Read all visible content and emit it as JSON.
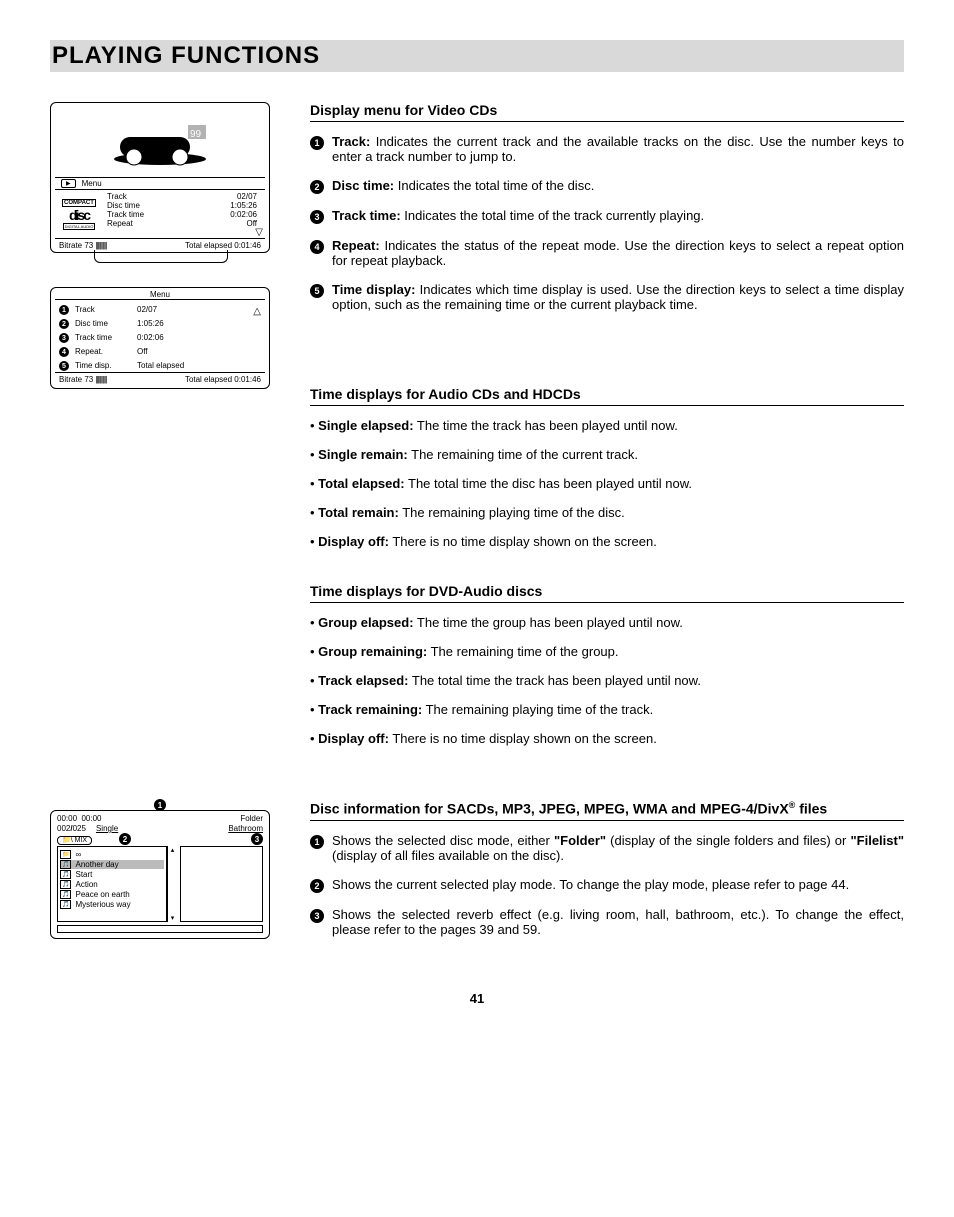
{
  "page_title": "PLAYING FUNCTIONS",
  "page_number": "41",
  "fig1": {
    "menu_label": "Menu",
    "rows": [
      {
        "label": "Track",
        "value": "02/07"
      },
      {
        "label": "Disc time",
        "value": "1:05:26"
      },
      {
        "label": "Track time",
        "value": "0:02:06"
      },
      {
        "label": "Repeat",
        "value": "Off"
      }
    ],
    "footer_left": "Bitrate 73",
    "footer_right": "Total elapsed 0:01:46",
    "compact_top": "COMPACT",
    "compact_bottom": "DIGITAL AUDIO"
  },
  "fig2": {
    "menu_label": "Menu",
    "rows": [
      {
        "num": "1",
        "label": "Track",
        "value": "02/07"
      },
      {
        "num": "2",
        "label": "Disc time",
        "value": "1:05:26"
      },
      {
        "num": "3",
        "label": "Track time",
        "value": "0:02:06"
      },
      {
        "num": "4",
        "label": "Repeat.",
        "value": "Off"
      },
      {
        "num": "5",
        "label": "Time disp.",
        "value": "Total elapsed"
      }
    ],
    "footer_left": "Bitrate 73",
    "footer_right": "Total elapsed 0:01:46"
  },
  "fig3": {
    "top_left_a": "00:00",
    "top_left_b": "00:00",
    "top_right": "Folder",
    "sec_left_a": "002",
    "sec_left_b": "025",
    "sec_mid": "Single",
    "sec_reverb": "Bathroom",
    "mix_label": "MIX",
    "items": [
      {
        "icon": "📁",
        "label": "∞"
      },
      {
        "icon": "🎵",
        "label": "Another day",
        "sel": true
      },
      {
        "icon": "🎵",
        "label": "Start"
      },
      {
        "icon": "🎵",
        "label": "Action"
      },
      {
        "icon": "🎵",
        "label": "Peace on earth"
      },
      {
        "icon": "🎵",
        "label": "Mysterious way"
      }
    ],
    "scroll_up": "▴",
    "scroll_dn": "▾"
  },
  "sec1": {
    "heading": "Display menu for Video CDs",
    "items": [
      {
        "num": "1",
        "label": "Track:",
        "text": "Indicates the current track and the available tracks on the disc. Use the number keys to enter a track number to jump to."
      },
      {
        "num": "2",
        "label": "Disc time:",
        "text": "Indicates the total time of the disc."
      },
      {
        "num": "3",
        "label": "Track time:",
        "text": "Indicates the total time of the track currently playing."
      },
      {
        "num": "4",
        "label": "Repeat:",
        "text": "Indicates the status of the repeat mode. Use the direction keys to select a repeat option for repeat playback."
      },
      {
        "num": "5",
        "label": "Time display:",
        "text": "Indicates which time display is used. Use the direction keys to select a time display option, such as  the remaining time or the current playback time."
      }
    ]
  },
  "sec2": {
    "heading": "Time displays for Audio CDs and HDCDs",
    "items": [
      {
        "label": "Single elapsed:",
        "text": "The time the track has been played until now."
      },
      {
        "label": "Single remain:",
        "text": "The remaining time of the current track."
      },
      {
        "label": "Total elapsed:",
        "text": "The total time the disc has been played until now."
      },
      {
        "label": "Total remain:",
        "text": "The remaining playing time of the disc."
      },
      {
        "label": "Display off:",
        "text": "There is no time display shown on the screen."
      }
    ]
  },
  "sec3": {
    "heading": "Time displays for DVD-Audio discs",
    "items": [
      {
        "label": "Group elapsed:",
        "text": "The time the group has been played until now."
      },
      {
        "label": "Group remaining:",
        "text": "The remaining time of the group."
      },
      {
        "label": "Track elapsed:",
        "text": "The total time the track has been played until now."
      },
      {
        "label": "Track remaining:",
        "text": "The remaining playing time of the track."
      },
      {
        "label": "Display off:",
        "text": "There is no time display shown on the screen."
      }
    ]
  },
  "sec4": {
    "heading_a": "Disc information for SACDs, MP3, JPEG, MPEG, WMA and MPEG-4/DivX",
    "heading_b": " files",
    "items": [
      {
        "num": "1",
        "pre": "Shows the selected disc mode, either ",
        "q1": "\"Folder\"",
        "mid": " (display of the single folders and files) or ",
        "q2": "\"Filelist\"",
        "post": " (display of all files available on the disc)."
      },
      {
        "num": "2",
        "text": "Shows the current selected play mode. To change the play mode, please refer to page 44."
      },
      {
        "num": "3",
        "text": "Shows the selected reverb effect (e.g. living room, hall, bathroom, etc.). To change the effect, please refer to the pages 39 and 59."
      }
    ]
  }
}
